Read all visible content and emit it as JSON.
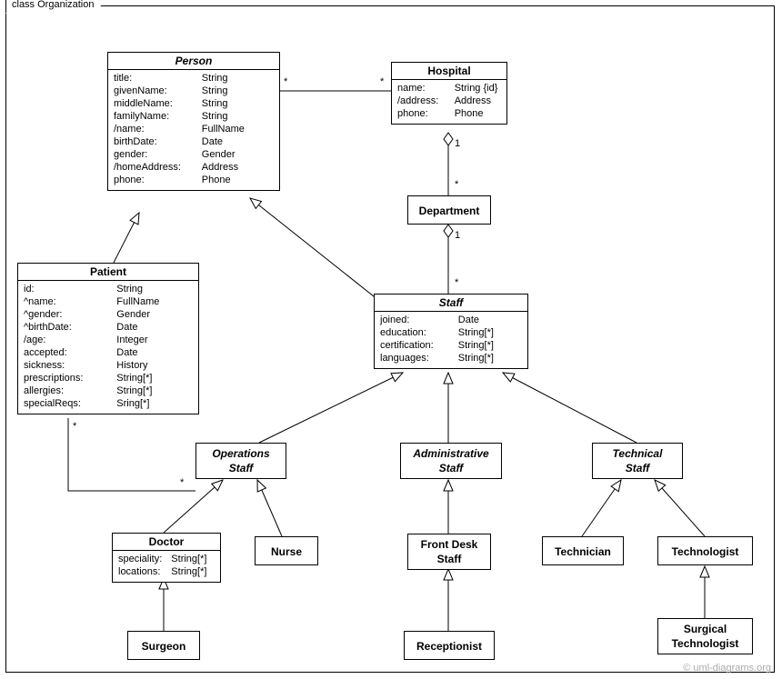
{
  "frame_label": "class Organization",
  "watermark": "© uml-diagrams.org",
  "classes": {
    "person": {
      "name": "Person",
      "attrs": [
        {
          "k": "title:",
          "v": "String"
        },
        {
          "k": "givenName:",
          "v": "String"
        },
        {
          "k": "middleName:",
          "v": "String"
        },
        {
          "k": "familyName:",
          "v": "String"
        },
        {
          "k": "/name:",
          "v": "FullName"
        },
        {
          "k": "birthDate:",
          "v": "Date"
        },
        {
          "k": "gender:",
          "v": "Gender"
        },
        {
          "k": "/homeAddress:",
          "v": "Address"
        },
        {
          "k": "phone:",
          "v": "Phone"
        }
      ]
    },
    "hospital": {
      "name": "Hospital",
      "attrs": [
        {
          "k": "name:",
          "v": "String {id}"
        },
        {
          "k": "/address:",
          "v": "Address"
        },
        {
          "k": "phone:",
          "v": "Phone"
        }
      ]
    },
    "department": {
      "name": "Department"
    },
    "patient": {
      "name": "Patient",
      "attrs": [
        {
          "k": "id:",
          "v": "String"
        },
        {
          "k": "^name:",
          "v": "FullName"
        },
        {
          "k": "^gender:",
          "v": "Gender"
        },
        {
          "k": "^birthDate:",
          "v": "Date"
        },
        {
          "k": "/age:",
          "v": "Integer"
        },
        {
          "k": "accepted:",
          "v": "Date"
        },
        {
          "k": "sickness:",
          "v": "History"
        },
        {
          "k": "prescriptions:",
          "v": "String[*]"
        },
        {
          "k": "allergies:",
          "v": "String[*]"
        },
        {
          "k": "specialReqs:",
          "v": "Sring[*]"
        }
      ]
    },
    "staff": {
      "name": "Staff",
      "attrs": [
        {
          "k": "joined:",
          "v": "Date"
        },
        {
          "k": "education:",
          "v": "String[*]"
        },
        {
          "k": "certification:",
          "v": "String[*]"
        },
        {
          "k": "languages:",
          "v": "String[*]"
        }
      ]
    },
    "opstaff": {
      "name": "Operations\nStaff"
    },
    "adminstaff": {
      "name": "Administrative\nStaff"
    },
    "techstaff": {
      "name": "Technical\nStaff"
    },
    "doctor": {
      "name": "Doctor",
      "attrs": [
        {
          "k": "speciality:",
          "v": "String[*]"
        },
        {
          "k": "locations:",
          "v": "String[*]"
        }
      ]
    },
    "nurse": {
      "name": "Nurse"
    },
    "frontdesk": {
      "name": "Front Desk\nStaff"
    },
    "receptionist": {
      "name": "Receptionist"
    },
    "surgeon": {
      "name": "Surgeon"
    },
    "technician": {
      "name": "Technician"
    },
    "technologist": {
      "name": "Technologist"
    },
    "surgtech": {
      "name": "Surgical\nTechnologist"
    }
  },
  "multiplicities": {
    "person_hospital_left": "*",
    "person_hospital_right": "*",
    "hospital_department_top": "1",
    "hospital_department_bot": "*",
    "department_staff_top": "1",
    "department_staff_bot": "*",
    "patient_opstaff_left": "*",
    "patient_opstaff_right": "*"
  }
}
